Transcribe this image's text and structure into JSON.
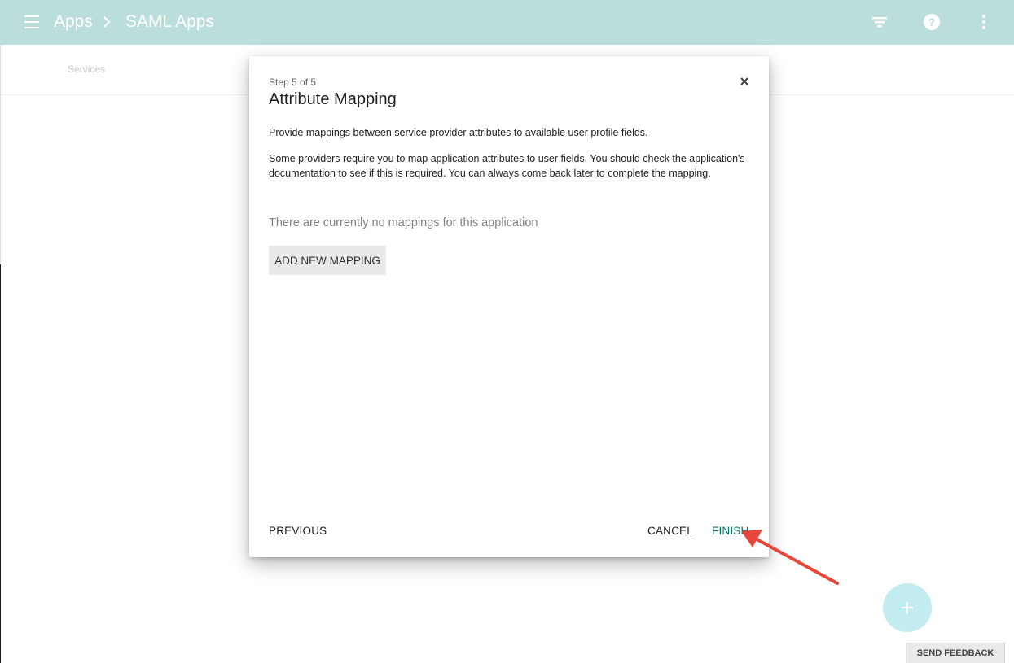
{
  "header": {
    "breadcrumb": [
      "Apps",
      "SAML Apps"
    ],
    "icons": [
      "menu-icon",
      "filter-icon",
      "help-icon",
      "more-vert-icon"
    ]
  },
  "subnav": {
    "tab_label": "Services"
  },
  "dialog": {
    "step_label": "Step 5 of 5",
    "title": "Attribute Mapping",
    "description_1": "Provide mappings between service provider attributes to available user profile fields.",
    "description_2": "Some providers require you to map application attributes to user fields. You should check the application's documentation to see if this is required. You can always come back later to complete the mapping.",
    "empty_message": "There are currently no mappings for this application",
    "add_mapping_label": "ADD NEW MAPPING",
    "previous_label": "PREVIOUS",
    "cancel_label": "CANCEL",
    "finish_label": "FINISH"
  },
  "feedback_label": "SEND FEEDBACK",
  "colors": {
    "header_bg": "#bcdedb",
    "finish_accent": "#00796b",
    "fab_bg": "#c2ecf0",
    "annotation_arrow": "#e8463a"
  }
}
